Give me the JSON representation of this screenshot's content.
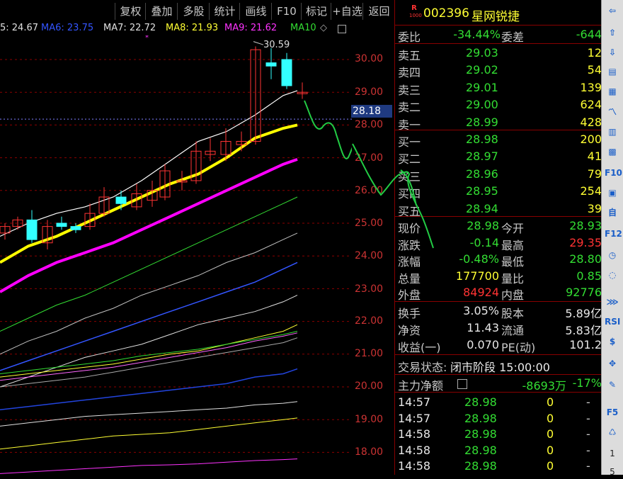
{
  "toolbar": {
    "buttons": [
      "复权",
      "叠加",
      "多股",
      "统计",
      "画线",
      "F10",
      "标记",
      "+自选",
      "返回"
    ]
  },
  "ma_bar": {
    "items": [
      {
        "label": "5: 24.67",
        "color": "#e0e0e0"
      },
      {
        "label": "MA6: 23.75",
        "color": "#3355ff"
      },
      {
        "label": "MA7: 22.72",
        "color": "#e0e0e0"
      },
      {
        "label": "MA8: 21.93",
        "color": "#ffff33"
      },
      {
        "label": "MA9: 21.62",
        "color": "#ff33ff"
      },
      {
        "label": "MA10",
        "color": "#33dd33"
      }
    ],
    "toggle_symbol": "◇"
  },
  "chart": {
    "price_ticks": [
      "30.00",
      "29.00",
      "28.00",
      "27.00",
      "26.00",
      "25.00",
      "24.00",
      "23.00",
      "22.00",
      "21.00",
      "20.00",
      "19.00",
      "18.00"
    ],
    "current_price": "28.18",
    "high_annotation": "30.59",
    "colors": {
      "up": "#ff3333",
      "down": "#33ffff",
      "grid": "#8b0000"
    }
  },
  "panel": {
    "stock_code": "002396",
    "stock_name": "星网锐捷",
    "badge": "R",
    "badge_sub": "1000",
    "weibi_label": "委比",
    "weibi_value": "-34.44%",
    "weicha_label": "委差",
    "weicha_value": "-644",
    "sell": [
      {
        "label": "卖五",
        "price": "29.03",
        "vol": "12"
      },
      {
        "label": "卖四",
        "price": "29.02",
        "vol": "54"
      },
      {
        "label": "卖三",
        "price": "29.01",
        "vol": "139"
      },
      {
        "label": "卖二",
        "price": "29.00",
        "vol": "624"
      },
      {
        "label": "卖一",
        "price": "28.99",
        "vol": "428"
      }
    ],
    "buy": [
      {
        "label": "买一",
        "price": "28.98",
        "vol": "200"
      },
      {
        "label": "买二",
        "price": "28.97",
        "vol": "41"
      },
      {
        "label": "买三",
        "price": "28.96",
        "vol": "79"
      },
      {
        "label": "买四",
        "price": "28.95",
        "vol": "254"
      },
      {
        "label": "买五",
        "price": "28.94",
        "vol": "39"
      }
    ],
    "quote": [
      {
        "l1": "现价",
        "v1": "28.98",
        "c1": "grn",
        "l2": "今开",
        "v2": "28.93",
        "c2": "grn"
      },
      {
        "l1": "涨跌",
        "v1": "-0.14",
        "c1": "grn",
        "l2": "最高",
        "v2": "29.35",
        "c2": "red"
      },
      {
        "l1": "涨幅",
        "v1": "-0.48%",
        "c1": "grn",
        "l2": "最低",
        "v2": "28.80",
        "c2": "grn"
      },
      {
        "l1": "总量",
        "v1": "177700",
        "c1": "yel",
        "l2": "量比",
        "v2": "0.85",
        "c2": "grn"
      },
      {
        "l1": "外盘",
        "v1": "84924",
        "c1": "red",
        "l2": "内盘",
        "v2": "92776",
        "c2": "grn"
      }
    ],
    "fund": [
      {
        "l1": "换手",
        "v1": "3.05%",
        "l2": "股本",
        "v2": "5.89亿"
      },
      {
        "l1": "净资",
        "v1": "11.43",
        "l2": "流通",
        "v2": "5.83亿"
      },
      {
        "l1": "收益(一)",
        "v1": "0.070",
        "l2": "PE(动)",
        "v2": "101.2"
      }
    ],
    "trade_status_label": "交易状态:",
    "trade_status_value": "闭市阶段 15:00:00",
    "main_flow_label": "主力净额",
    "main_flow_value": "-8693万",
    "main_flow_pct": "-17%",
    "ticks": [
      {
        "time": "14:57",
        "price": "28.98",
        "vol": "0",
        "dir": "-"
      },
      {
        "time": "14:57",
        "price": "28.98",
        "vol": "0",
        "dir": "-"
      },
      {
        "time": "14:58",
        "price": "28.98",
        "vol": "0",
        "dir": "-"
      },
      {
        "time": "14:58",
        "price": "28.98",
        "vol": "0",
        "dir": "-"
      },
      {
        "time": "14:58",
        "price": "28.98",
        "vol": "0",
        "dir": "-"
      }
    ]
  },
  "iconbar": {
    "icons": [
      {
        "name": "arrow-left-icon",
        "glyph": "⇦"
      },
      {
        "name": "arrow-up-icon",
        "glyph": "⇧"
      },
      {
        "name": "arrow-down-icon",
        "glyph": "⇩"
      },
      {
        "name": "report-icon",
        "glyph": "▤"
      },
      {
        "name": "table-icon",
        "glyph": "▦"
      },
      {
        "name": "line-chart-icon",
        "glyph": "〽"
      },
      {
        "name": "bar-chart-icon",
        "glyph": "▥"
      },
      {
        "name": "info-icon",
        "glyph": "▩"
      },
      {
        "name": "f10-icon",
        "glyph": "F10"
      },
      {
        "name": "sector-icon",
        "glyph": "▣"
      },
      {
        "name": "custom-icon",
        "glyph": "自"
      },
      {
        "name": "f12-icon",
        "glyph": "F12"
      },
      {
        "name": "time-icon",
        "glyph": "◷"
      },
      {
        "name": "refresh-icon",
        "glyph": "◌"
      },
      {
        "name": "indicator-icon",
        "glyph": "⋙"
      },
      {
        "name": "rsi-icon",
        "glyph": "RSI"
      },
      {
        "name": "dollar-icon",
        "glyph": "$"
      },
      {
        "name": "move-icon",
        "glyph": "✥"
      },
      {
        "name": "draw-icon",
        "glyph": "✎"
      },
      {
        "name": "f5-icon",
        "glyph": "F5"
      },
      {
        "name": "recycle-icon",
        "glyph": "♺"
      },
      {
        "name": "page-one-label",
        "glyph": "1"
      },
      {
        "name": "page-five-label",
        "glyph": "5"
      }
    ]
  }
}
